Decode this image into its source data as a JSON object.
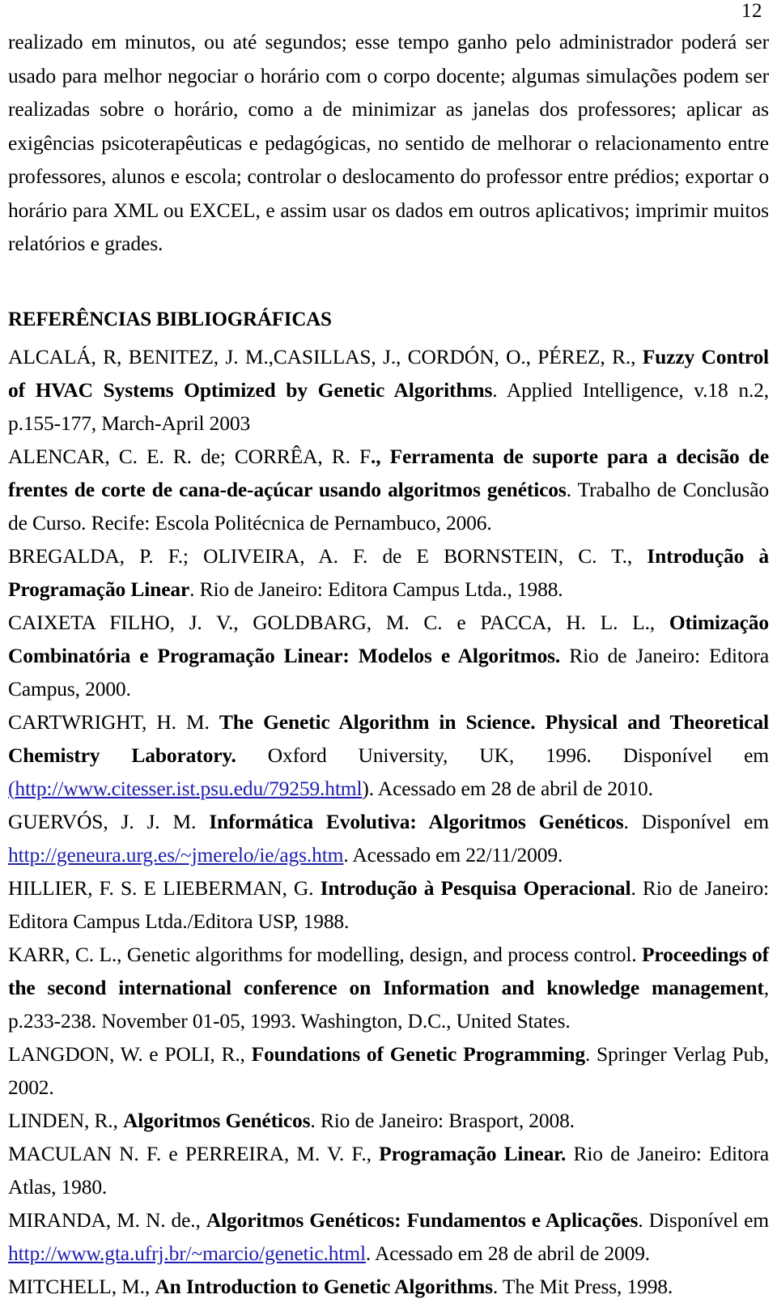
{
  "page": {
    "number": "12"
  },
  "body": {
    "paragraph": "realizado em minutos, ou até segundos; esse tempo ganho pelo administrador poderá ser usado para melhor negociar o horário com o corpo docente; algumas simulações podem ser realizadas sobre o horário, como a de minimizar as janelas dos professores; aplicar as exigências psicoterapêuticas e pedagógicas, no sentido de melhorar o relacionamento entre professores, alunos e escola; controlar o deslocamento do professor entre prédios; exportar o horário para XML ou EXCEL, e assim usar os dados em outros aplicativos; imprimir muitos relatórios e grades."
  },
  "references": {
    "heading": "REFERÊNCIAS BIBLIOGRÁFICAS",
    "items": [
      {
        "id": "alcala",
        "pre": "ALCALÁ, R, BENITEZ, J. M.,CASILLAS, J., CORDÓN, O., PÉREZ, R., ",
        "bold": "Fuzzy Control of HVAC Systems Optimized by Genetic Algorithms",
        "post": ". Applied Intelligence, v.18 n.2, p.155-177, March-April 2003"
      },
      {
        "id": "alencar",
        "pre": "ALENCAR, C. E. R. de; CORRÊA, R. F",
        "bold": "., Ferramenta de suporte para a decisão de frentes de corte de cana-de-açúcar usando algoritmos genéticos",
        "post": ". Trabalho de Conclusão de Curso. Recife: Escola Politécnica de Pernambuco, 2006."
      },
      {
        "id": "bregalda",
        "pre": "BREGALDA, P. F.; OLIVEIRA, A. F. de E BORNSTEIN, C. T., ",
        "bold": "Introdução à Programação Linear",
        "post": ". Rio de Janeiro: Editora Campus Ltda., 1988."
      },
      {
        "id": "caixeta",
        "pre": "CAIXETA FILHO, J. V., GOLDBARG, M. C. e PACCA, H. L. L., ",
        "bold": "Otimização Combinatória e Programação Linear: Modelos e Algoritmos.",
        "post": " Rio de Janeiro: Editora Campus, 2000."
      },
      {
        "id": "cartwright",
        "pre": "CARTWRIGHT, H. M. ",
        "bold": "The Genetic Algorithm in Science. Physical and Theoretical Chemistry Laboratory.",
        "post": " Oxford University, UK, 1996. Disponível em ",
        "url_prefix": "(",
        "url": "http://www.citesser.ist.psu.edu/79259.html",
        "tail": "). Acessado em 28 de abril de 2010."
      },
      {
        "id": "guervos",
        "pre": "GUERVÓS, J. J. M. ",
        "bold": "Informática Evolutiva: Algoritmos Genéticos",
        "post": ". Disponível em ",
        "url": "http://geneura.urg.es/~jmerelo/ie/ags.htm",
        "tail": ". Acessado em 22/11/2009."
      },
      {
        "id": "hillier",
        "pre": "HILLIER, F. S. E LIEBERMAN, G. ",
        "bold": "Introdução à Pesquisa Operacional",
        "post": ". Rio de Janeiro: Editora Campus Ltda./Editora USP, 1988."
      },
      {
        "id": "karr",
        "pre": "KARR, C. L., Genetic algorithms for modelling, design, and process control. ",
        "bold": "Proceedings of the second international conference on Information and knowledge management",
        "post": ", p.233-238. November 01-05, 1993. Washington, D.C., United States."
      },
      {
        "id": "langdon",
        "pre": "LANGDON, W. e POLI, R., ",
        "bold": "Foundations of Genetic Programming",
        "post": ". Springer Verlag Pub, 2002."
      },
      {
        "id": "linden",
        "pre": "LINDEN, R., ",
        "bold": "Algoritmos Genéticos",
        "post": ". Rio de Janeiro: Brasport, 2008."
      },
      {
        "id": "maculan",
        "pre": "MACULAN N. F. e PERREIRA, M. V. F., ",
        "bold": "Programação Linear.",
        "post": " Rio de Janeiro: Editora Atlas, 1980."
      },
      {
        "id": "miranda",
        "pre": "MIRANDA, M. N. de., ",
        "bold": "Algoritmos Genéticos: Fundamentos e Aplicações",
        "post": ". Disponível em ",
        "url": "http://www.gta.ufrj.br/~marcio/genetic.html",
        "tail": ". Acessado em 28 de abril de 2009."
      },
      {
        "id": "mitchell",
        "pre": "MITCHELL, M., ",
        "bold": "An Introduction to Genetic Algorithms",
        "post": ". The Mit Press, 1998."
      }
    ]
  },
  "colors": {
    "link": "#2020B0",
    "text": "#000000",
    "background": "#ffffff"
  }
}
